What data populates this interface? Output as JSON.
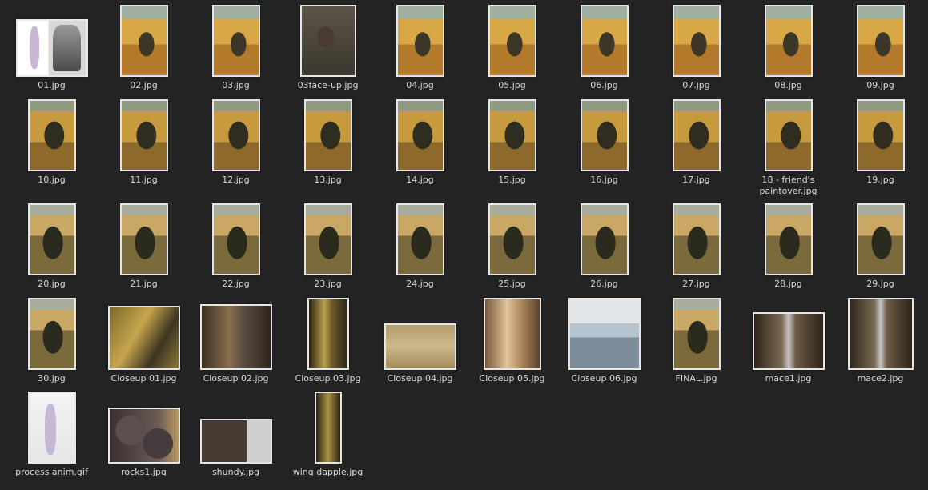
{
  "files": [
    {
      "name": "01.jpg",
      "art": "t-sketch",
      "w": 90,
      "h": 72
    },
    {
      "name": "02.jpg",
      "art": "t-paint-a",
      "w": 60,
      "h": 90
    },
    {
      "name": "03.jpg",
      "art": "t-paint-a",
      "w": 60,
      "h": 90
    },
    {
      "name": "03face-up.jpg",
      "art": "t-face",
      "w": 70,
      "h": 90
    },
    {
      "name": "04.jpg",
      "art": "t-paint-a",
      "w": 60,
      "h": 90
    },
    {
      "name": "05.jpg",
      "art": "t-paint-a",
      "w": 60,
      "h": 90
    },
    {
      "name": "06.jpg",
      "art": "t-paint-a",
      "w": 60,
      "h": 90
    },
    {
      "name": "07.jpg",
      "art": "t-paint-a",
      "w": 60,
      "h": 90
    },
    {
      "name": "08.jpg",
      "art": "t-paint-a",
      "w": 60,
      "h": 90
    },
    {
      "name": "09.jpg",
      "art": "t-paint-a",
      "w": 60,
      "h": 90
    },
    {
      "name": "10.jpg",
      "art": "t-paint-b",
      "w": 60,
      "h": 90
    },
    {
      "name": "11.jpg",
      "art": "t-paint-b",
      "w": 60,
      "h": 90
    },
    {
      "name": "12.jpg",
      "art": "t-paint-b",
      "w": 60,
      "h": 90
    },
    {
      "name": "13.jpg",
      "art": "t-paint-b",
      "w": 60,
      "h": 90
    },
    {
      "name": "14.jpg",
      "art": "t-paint-b",
      "w": 60,
      "h": 90
    },
    {
      "name": "15.jpg",
      "art": "t-paint-b",
      "w": 60,
      "h": 90
    },
    {
      "name": "16.jpg",
      "art": "t-paint-b",
      "w": 60,
      "h": 90
    },
    {
      "name": "17.jpg",
      "art": "t-paint-b",
      "w": 60,
      "h": 90
    },
    {
      "name": "18 - friend's paintover.jpg",
      "art": "t-paint-b",
      "w": 60,
      "h": 90
    },
    {
      "name": "19.jpg",
      "art": "t-paint-b",
      "w": 60,
      "h": 90
    },
    {
      "name": "20.jpg",
      "art": "t-paint-c",
      "w": 60,
      "h": 90
    },
    {
      "name": "21.jpg",
      "art": "t-paint-c",
      "w": 60,
      "h": 90
    },
    {
      "name": "22.jpg",
      "art": "t-paint-c",
      "w": 60,
      "h": 90
    },
    {
      "name": "23.jpg",
      "art": "t-paint-c",
      "w": 60,
      "h": 90
    },
    {
      "name": "24.jpg",
      "art": "t-paint-c",
      "w": 60,
      "h": 90
    },
    {
      "name": "25.jpg",
      "art": "t-paint-c",
      "w": 60,
      "h": 90
    },
    {
      "name": "26.jpg",
      "art": "t-paint-c",
      "w": 60,
      "h": 90
    },
    {
      "name": "27.jpg",
      "art": "t-paint-c",
      "w": 60,
      "h": 90
    },
    {
      "name": "28.jpg",
      "art": "t-paint-c",
      "w": 60,
      "h": 90
    },
    {
      "name": "29.jpg",
      "art": "t-paint-c",
      "w": 60,
      "h": 90
    },
    {
      "name": "30.jpg",
      "art": "t-paint-c",
      "w": 60,
      "h": 90
    },
    {
      "name": "Closeup 01.jpg",
      "art": "t-closeup1",
      "w": 90,
      "h": 80
    },
    {
      "name": "Closeup 02.jpg",
      "art": "t-closeup2",
      "w": 90,
      "h": 82
    },
    {
      "name": "Closeup 03.jpg",
      "art": "t-closeup3",
      "w": 52,
      "h": 90
    },
    {
      "name": "Closeup 04.jpg",
      "art": "t-closeup4",
      "w": 90,
      "h": 58
    },
    {
      "name": "Closeup 05.jpg",
      "art": "t-closeup5",
      "w": 72,
      "h": 90
    },
    {
      "name": "Closeup 06.jpg",
      "art": "t-closeup6",
      "w": 90,
      "h": 90
    },
    {
      "name": "FINAL.jpg",
      "art": "t-paint-c",
      "w": 60,
      "h": 90
    },
    {
      "name": "mace1.jpg",
      "art": "t-mace",
      "w": 90,
      "h": 72
    },
    {
      "name": "mace2.jpg",
      "art": "t-mace",
      "w": 82,
      "h": 90
    },
    {
      "name": "process anim.gif",
      "art": "t-process",
      "w": 60,
      "h": 90
    },
    {
      "name": "rocks1.jpg",
      "art": "t-rocks",
      "w": 90,
      "h": 70
    },
    {
      "name": "shundy.jpg",
      "art": "t-shundy",
      "w": 90,
      "h": 56
    },
    {
      "name": "wing dapple.jpg",
      "art": "t-wing",
      "w": 34,
      "h": 90
    }
  ]
}
